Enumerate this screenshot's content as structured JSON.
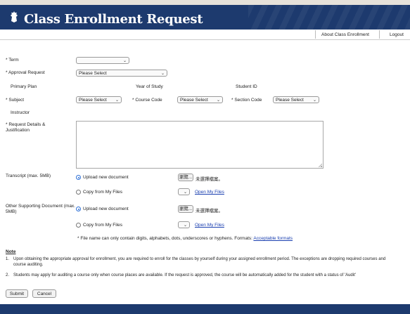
{
  "header": {
    "title": "Class Enrollment Request"
  },
  "toplinks": {
    "about": "About Class Enrollment",
    "logout": "Logout"
  },
  "form": {
    "term_label": "* Term",
    "term_value": "",
    "approval_label": "* Approval Request",
    "approval_value": "Please Select",
    "primary_plan_label": "Primary Plan",
    "year_of_study_label": "Year of Study",
    "student_id_label": "Student ID",
    "subject_label": "* Subject",
    "subject_value": "Please Select",
    "course_code_label": "* Course Code",
    "course_code_value": "Please Select",
    "section_code_label": "* Section Code",
    "section_code_value": "Please Select",
    "instructor_label": "Instructor",
    "details_label": "* Request Details & Justification",
    "transcript_label": "Transcript (max. 5MB)",
    "upload_new_label": "Upload new document",
    "copy_files_label": "Copy from My Files",
    "browse_label": "瀏覽...",
    "no_file_label": "未選擇檔案。",
    "open_files_label": "Open My Files",
    "other_doc_label": "Other Supporting Document (max. 5MB)",
    "file_note_text": "* File name can only contain digits, alphabets, dots, underscores or hyphens. Formats:",
    "formats_link": "Acceptable formats"
  },
  "notes": {
    "title": "Note",
    "items": [
      {
        "num": "1.",
        "text": "Upon obtaining the appropriate approval for enrollment, you are required to enroll for the classes by yourself during your assigned enrollment period. The exceptions are dropping required courses and course auditing."
      },
      {
        "num": "2.",
        "text": "Students may apply for auditing a course only when course places are available. If the request is approved, the course will be automatically added for the student with a status of 'Audit'"
      }
    ]
  },
  "actions": {
    "submit": "Submit",
    "cancel": "Cancel"
  }
}
